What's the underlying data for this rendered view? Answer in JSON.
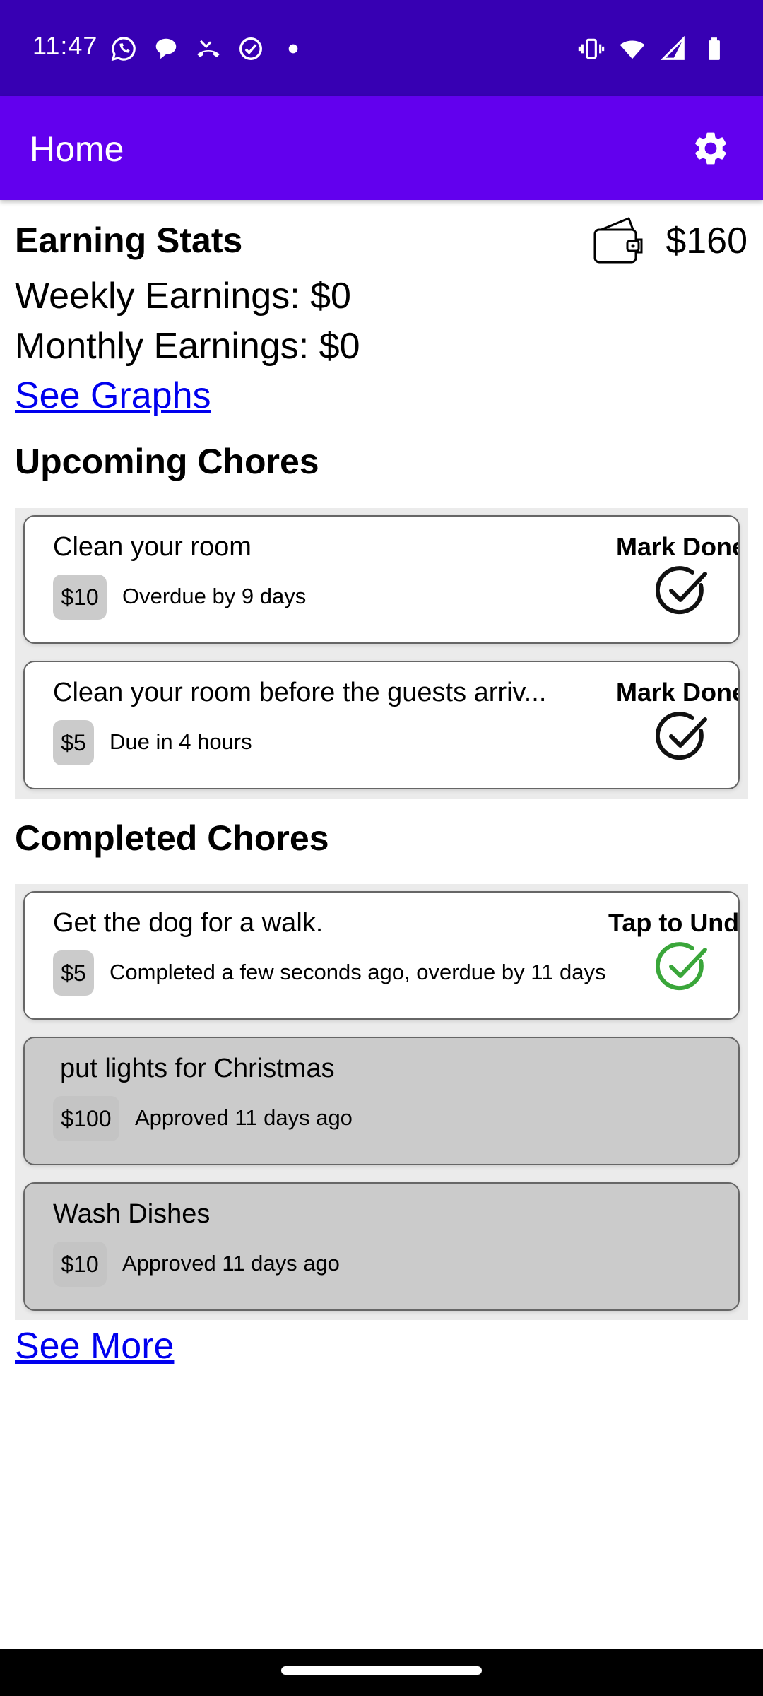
{
  "status_bar": {
    "time": "11:47",
    "left_icons": [
      "whatsapp-icon",
      "chat-bubble-icon",
      "missed-call-icon",
      "check-circle-icon",
      "dot-icon"
    ],
    "right_icons": [
      "vibrate-icon",
      "wifi-icon",
      "signal-icon",
      "battery-icon"
    ]
  },
  "app_bar": {
    "title": "Home",
    "settings_icon": "gear-icon",
    "color": "#6200ee"
  },
  "earnings": {
    "heading": "Earning Stats",
    "weekly": "Weekly Earnings: $0",
    "monthly": "Monthly Earnings: $0",
    "see_graphs": "See Graphs",
    "wallet_icon": "wallet-icon",
    "balance": "$160"
  },
  "upcoming": {
    "heading": "Upcoming Chores",
    "chores": [
      {
        "title": "Clean your room",
        "amount": "$10",
        "due": "Overdue by 9 days",
        "action": "Mark Done"
      },
      {
        "title": "Clean your room before the guests arriv...",
        "amount": "$5",
        "due": "Due in 4 hours",
        "action": "Mark Done"
      }
    ]
  },
  "completed": {
    "heading": "Completed Chores",
    "chores": [
      {
        "title": "Get the dog for a walk.",
        "amount": "$5",
        "status": "Completed a few seconds ago, overdue by 11 days",
        "action": "Tap to Undo"
      },
      {
        "title": "put lights for Christmas",
        "amount": "$100",
        "status": "Approved 11 days ago"
      },
      {
        "title": "Wash Dishes",
        "amount": "$10",
        "status": "Approved 11 days ago"
      }
    ],
    "see_more": "See More"
  },
  "colors": {
    "status_bar": "#3700b3",
    "app_bar": "#6200ee",
    "link": "#0000ee",
    "check_done": "#3aa63a"
  }
}
